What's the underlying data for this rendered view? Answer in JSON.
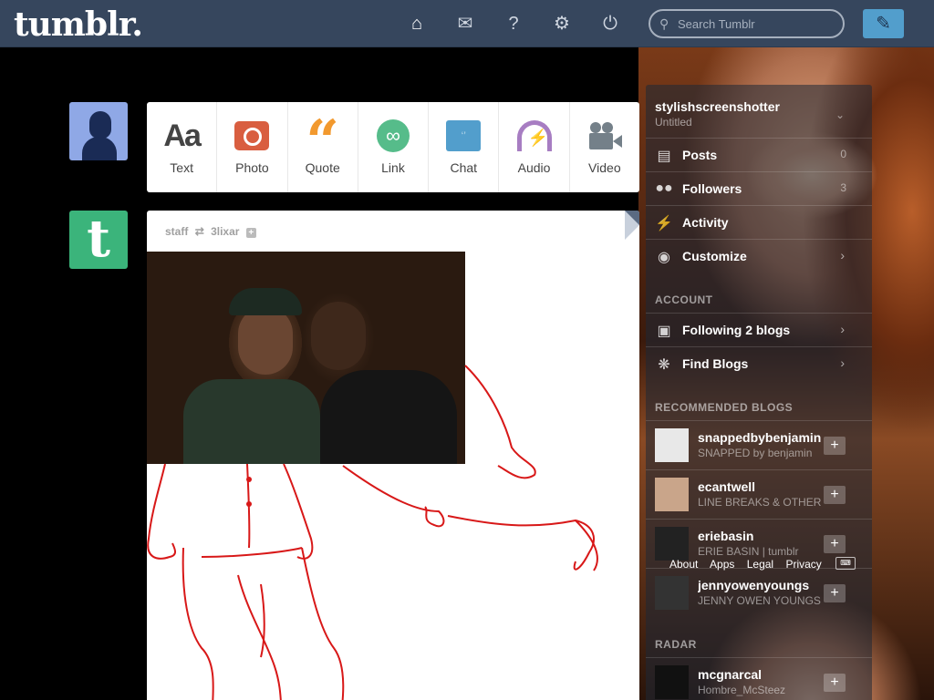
{
  "header": {
    "logo": "tumblr.",
    "search_placeholder": "Search Tumblr",
    "nav": [
      {
        "icon": "home-icon",
        "glyph": "⌂"
      },
      {
        "icon": "mail-icon",
        "glyph": "✉"
      },
      {
        "icon": "help-icon",
        "glyph": "?"
      },
      {
        "icon": "gear-icon",
        "glyph": "⚙"
      },
      {
        "icon": "power-icon",
        "glyph": "⏻"
      }
    ],
    "compose_glyph": "✎"
  },
  "post_types": [
    {
      "label": "Text",
      "icon": "text-icon",
      "color": "#444444"
    },
    {
      "label": "Photo",
      "icon": "photo-icon",
      "color": "#d95e40"
    },
    {
      "label": "Quote",
      "icon": "quote-icon",
      "color": "#f2992e"
    },
    {
      "label": "Link",
      "icon": "link-icon",
      "color": "#56bc8a"
    },
    {
      "label": "Chat",
      "icon": "chat-icon",
      "color": "#529ecc"
    },
    {
      "label": "Audio",
      "icon": "audio-icon",
      "color": "#a77dc2"
    },
    {
      "label": "Video",
      "icon": "video-icon",
      "color": "#748089"
    }
  ],
  "post": {
    "author": "staff",
    "reblogged_from": "3lixar"
  },
  "sidebar": {
    "blog_name": "stylishscreenshotter",
    "blog_sub": "Untitled",
    "items": [
      {
        "label": "Posts",
        "count": "0"
      },
      {
        "label": "Followers",
        "count": "3"
      },
      {
        "label": "Activity",
        "count": ""
      },
      {
        "label": "Customize",
        "count": ""
      }
    ],
    "account_heading": "ACCOUNT",
    "account_items": [
      {
        "label": "Following 2 blogs"
      },
      {
        "label": "Find Blogs"
      }
    ],
    "recommended_heading": "RECOMMENDED BLOGS",
    "recommended": [
      {
        "name": "snappedbybenjamin",
        "title": "SNAPPED by benjamin"
      },
      {
        "name": "ecantwell",
        "title": "LINE BREAKS & OTHER"
      },
      {
        "name": "eriebasin",
        "title": "ERIE BASIN | tumblr"
      },
      {
        "name": "jennyowenyoungs",
        "title": "JENNY OWEN YOUNGS"
      }
    ],
    "footer_links": [
      "About",
      "Apps",
      "Legal",
      "Privacy"
    ],
    "radar_heading": "RADAR",
    "radar": {
      "name": "mcgnarcal",
      "title": "Hombre_McSteez"
    }
  }
}
